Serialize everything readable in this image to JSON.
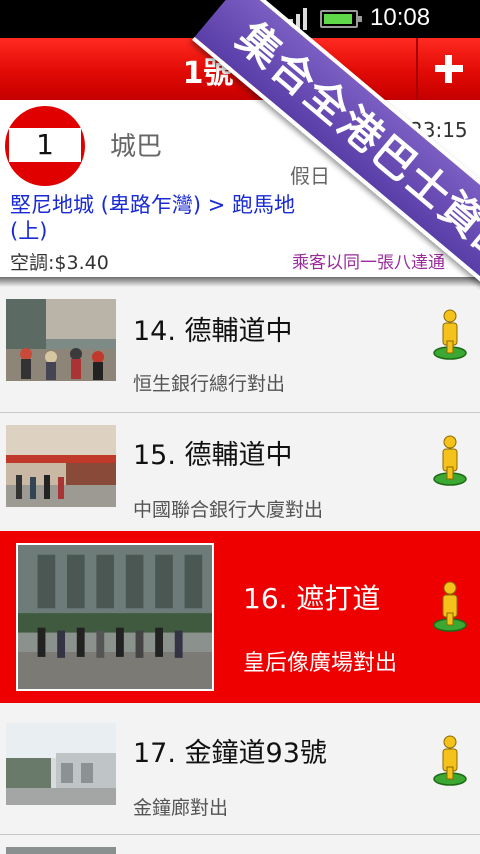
{
  "status_bar": {
    "time": "10:08"
  },
  "header": {
    "title": "1號"
  },
  "route": {
    "number": "1",
    "company": "城巴",
    "time": "23:15",
    "day_type": "假日",
    "name": "堅尼地城 (卑路乍灣) > 跑馬地(上)",
    "fare": "空調:$3.40",
    "interchange": "乘客以同一張八達通"
  },
  "stops": [
    {
      "name": "14. 德輔道中",
      "desc": "恒生銀行總行對出",
      "active": false
    },
    {
      "name": "15. 德輔道中",
      "desc": "中國聯合銀行大廈對出",
      "active": false
    },
    {
      "name": "16. 遮打道",
      "desc": "皇后像廣場對出",
      "active": true
    },
    {
      "name": "17. 金鐘道93號",
      "desc": "金鐘廊對出",
      "active": false
    }
  ],
  "promo": {
    "text": "集合全港巴士資訊"
  },
  "colors": {
    "brand_red": "#e10a05",
    "route_link": "#1a2bd4",
    "interchange": "#9a2a9a",
    "promo_purple": "#6a4eb8"
  }
}
